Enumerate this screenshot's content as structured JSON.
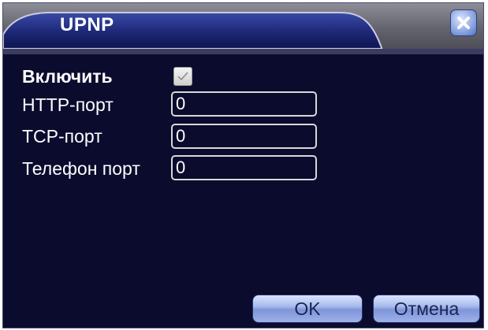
{
  "window": {
    "title": "UPNP",
    "close_icon": "close-icon"
  },
  "form": {
    "enable_label": "Включить",
    "enable_checked": true,
    "http_port_label": "HTTP-порт",
    "http_port_value": "0",
    "tcp_port_label": "TCP-порт",
    "tcp_port_value": "0",
    "phone_port_label": "Телефон порт",
    "phone_port_value": "0"
  },
  "buttons": {
    "ok_label": "OK",
    "cancel_label": "Отмена"
  },
  "colors": {
    "background": "#0b0b2e",
    "titlebar": "#6e6e78",
    "button": "#a9bbee",
    "text": "#ffffff"
  }
}
